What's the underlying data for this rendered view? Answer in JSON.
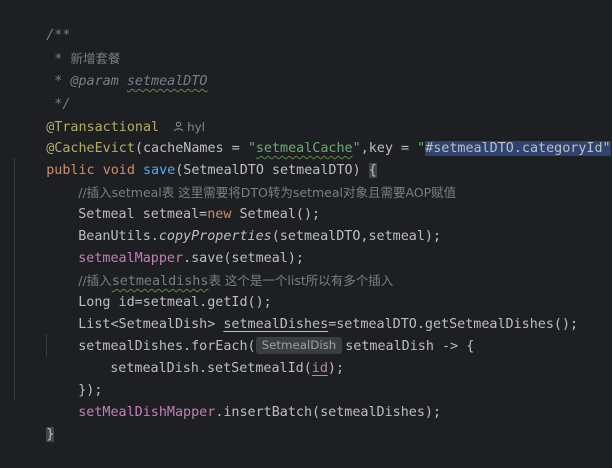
{
  "editor": {
    "language": "Java",
    "lines": {
      "l1": "/**",
      "l2_prefix": " * ",
      "l2_text": "新增套餐",
      "l3_prefix": " * ",
      "l3_tag": "@param",
      "l3_param": "setmealDTO",
      "l4": " */",
      "l5_annotation": "@Transactional",
      "l5_author": "hyl",
      "l6_annotation": "@CacheEvict",
      "l6_open": "(cacheNames = ",
      "l6_str1_q1": "\"",
      "l6_str1_word": "setmealCache",
      "l6_str1_q2": "\"",
      "l6_mid": ",key = ",
      "l6_str2_q1": "\"",
      "l6_str2": "#setmealDTO.categoryId\"",
      "l6_close": ")",
      "l7_public": "public",
      "l7_void": "void",
      "l7_method": "save",
      "l7_params": "(SetmealDTO setmealDTO) ",
      "l7_brace": "{",
      "l8_comment": "//插入setmeal表 这里需要将DTO转为setmeal对象且需要AOP赋值",
      "l9_a": "Setmeal setmeal=",
      "l9_new": "new",
      "l9_b": " Setmeal();",
      "l10_a": "BeanUtils.",
      "l10_method": "copyProperties",
      "l10_b": "(setmealDTO,setmeal);",
      "l11_field": "setmealMapper",
      "l11_b": ".save(setmeal);",
      "l12_a": "//插入",
      "l12_word": "setmealdishs",
      "l12_b": "表 这个是一个list所以有多个插入",
      "l13": "Long id=setmeal.getId();",
      "l14_a": "List<SetmealDish> ",
      "l14_var": "setmealDishes",
      "l14_b": "=setmealDTO.getSetmealDishes();",
      "l15_a": "setmealDishes.forEach(",
      "l15_hint": "SetmealDish",
      "l15_b": "setmealDish -> ",
      "l15_brace": "{",
      "l16_a": "setmealDish.setSetmealId(",
      "l16_id": "id",
      "l16_b": ");",
      "l17": "});",
      "l18_field": "setMealDishMapper",
      "l18_b": ".insertBatch(setmealDishes);",
      "l19": "}"
    }
  },
  "colors": {
    "background": "#1e1f22",
    "default_text": "#bcbec4",
    "keyword": "#cf8e6d",
    "string": "#6aab73",
    "annotation": "#b3ae60",
    "comment": "#7a7e85",
    "method": "#56a8f5",
    "field": "#c77dbb"
  }
}
